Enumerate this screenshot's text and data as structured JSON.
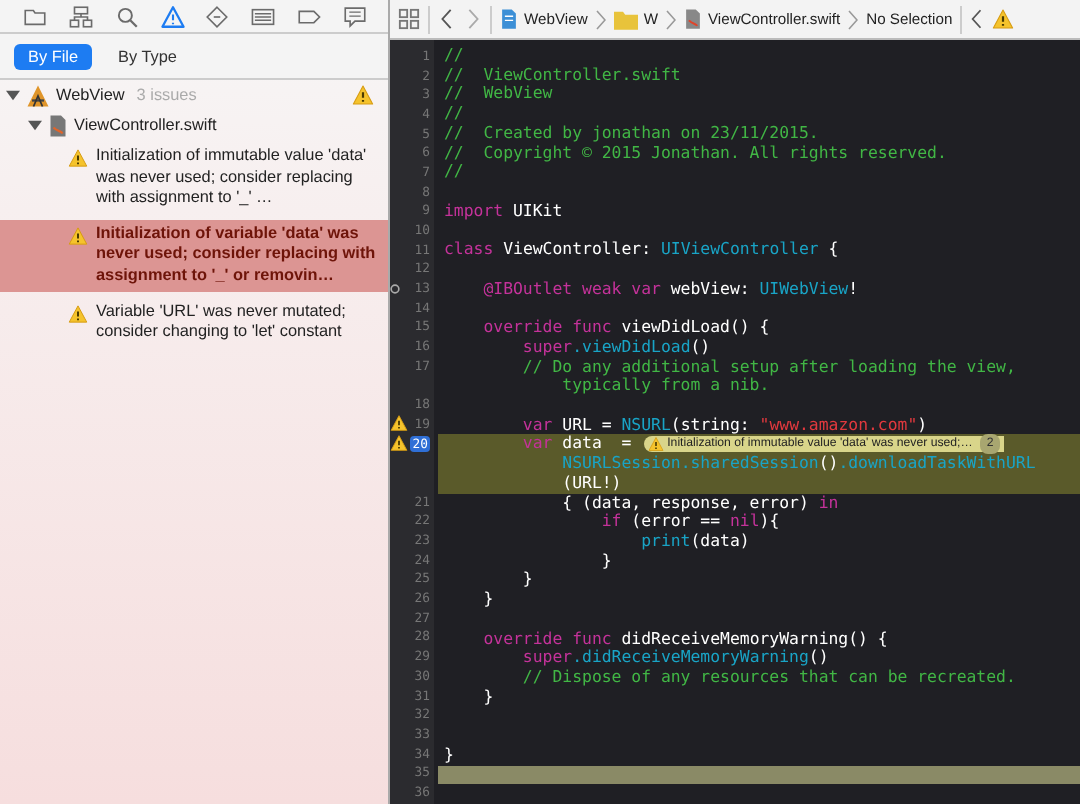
{
  "navigator": {
    "toolbar": [
      {
        "kind": "folder",
        "selected": false
      },
      {
        "kind": "hierarchy",
        "selected": false
      },
      {
        "kind": "search",
        "selected": false
      },
      {
        "kind": "warning",
        "selected": true
      },
      {
        "kind": "diamond",
        "selected": false
      },
      {
        "kind": "list",
        "selected": false
      },
      {
        "kind": "tag",
        "selected": false
      },
      {
        "kind": "bubble",
        "selected": false
      }
    ],
    "scope_tabs": [
      {
        "label": "By File",
        "selected": true
      },
      {
        "label": "By Type",
        "selected": false
      }
    ],
    "tree": {
      "label": "WebView",
      "count": "3 issues",
      "expanded": true,
      "children": [
        {
          "label": "ViewController.swift",
          "expanded": true,
          "children": [
            {
              "label": "Initialization of immutable value 'data' was never used; consider replacing with assignment to '_' …",
              "selected": false
            },
            {
              "label": "Initialization of variable 'data' was never used; consider replacing with assignment to '_' or removin…",
              "selected": true
            },
            {
              "label": "Variable 'URL' was never mutated; consider changing to 'let' constant",
              "selected": false
            }
          ]
        }
      ]
    }
  },
  "editor": {
    "jump_bar": [
      {
        "kind": "project",
        "label": "WebView"
      },
      {
        "kind": "folder",
        "label": "W"
      },
      {
        "kind": "file",
        "label": "ViewController.swift"
      },
      {
        "kind": "plain",
        "label": "No Selection"
      }
    ],
    "lines": [
      {
        "number": "1",
        "wraps": [
          {
            "tokens": [
              {
                "kind": "comment",
                "text": "//"
              }
            ]
          }
        ]
      },
      {
        "number": "2",
        "wraps": [
          {
            "tokens": [
              {
                "kind": "comment",
                "text": "//  ViewController.swift"
              }
            ]
          }
        ]
      },
      {
        "number": "3",
        "wraps": [
          {
            "tokens": [
              {
                "kind": "comment",
                "text": "//  WebView"
              }
            ]
          }
        ]
      },
      {
        "number": "4",
        "wraps": [
          {
            "tokens": [
              {
                "kind": "comment",
                "text": "//"
              }
            ]
          }
        ]
      },
      {
        "number": "5",
        "wraps": [
          {
            "tokens": [
              {
                "kind": "comment",
                "text": "//  Created by jonathan on 23/11/2015."
              }
            ]
          }
        ]
      },
      {
        "number": "6",
        "wraps": [
          {
            "tokens": [
              {
                "kind": "comment",
                "text": "//  Copyright © 2015 Jonathan. All rights reserved."
              }
            ]
          }
        ]
      },
      {
        "number": "7",
        "wraps": [
          {
            "tokens": [
              {
                "kind": "comment",
                "text": "//"
              }
            ]
          }
        ]
      },
      {
        "number": "8"
      },
      {
        "number": "9",
        "wraps": [
          {
            "tokens": [
              {
                "kind": "keyword",
                "text": "import"
              },
              {
                "kind": "plain",
                "text": " UIKit"
              }
            ]
          }
        ]
      },
      {
        "number": "10"
      },
      {
        "number": "11",
        "wraps": [
          {
            "tokens": [
              {
                "kind": "keyword",
                "text": "class"
              },
              {
                "kind": "plain",
                "text": " ViewController: "
              },
              {
                "kind": "type",
                "text": "UIViewController"
              },
              {
                "kind": "plain",
                "text": " {"
              }
            ]
          }
        ]
      },
      {
        "number": "12"
      },
      {
        "number": "13",
        "outlet": true,
        "wraps": [
          {
            "tokens": [
              {
                "kind": "keyword",
                "text": "    @IBOutlet weak var"
              },
              {
                "kind": "plain",
                "text": " webView: "
              },
              {
                "kind": "type",
                "text": "UIWebView"
              },
              {
                "kind": "plain",
                "text": "!"
              }
            ]
          }
        ]
      },
      {
        "number": "14"
      },
      {
        "number": "15",
        "wraps": [
          {
            "tokens": [
              {
                "kind": "keyword",
                "text": "    override func"
              },
              {
                "kind": "plain",
                "text": " viewDidLoad() {"
              }
            ]
          }
        ]
      },
      {
        "number": "16",
        "wraps": [
          {
            "tokens": [
              {
                "kind": "keyword",
                "text": "        super"
              },
              {
                "kind": "call",
                "text": ".viewDidLoad"
              },
              {
                "kind": "plain",
                "text": "()"
              }
            ]
          }
        ]
      },
      {
        "number": "17",
        "wraps": [
          {
            "tokens": [
              {
                "kind": "comment",
                "text": "        // Do any additional setup after loading the view,"
              }
            ]
          },
          {
            "tokens": [
              {
                "kind": "comment",
                "text": "            typically from a nib."
              }
            ]
          }
        ]
      },
      {
        "number": "18"
      },
      {
        "number": "19",
        "warning": true,
        "wraps": [
          {
            "tokens": [
              {
                "kind": "keyword",
                "text": "        var"
              },
              {
                "kind": "plain",
                "text": " URL = "
              },
              {
                "kind": "type",
                "text": "NSURL"
              },
              {
                "kind": "plain",
                "text": "(string: "
              },
              {
                "kind": "string",
                "text": "\"www.amazon.com\""
              },
              {
                "kind": "plain",
                "text": ")"
              }
            ]
          }
        ]
      },
      {
        "number": "20",
        "warning": true,
        "highlighted": true,
        "issue": {
          "message": "Initialization of immutable value 'data' was never used;…",
          "count": "2"
        },
        "wraps": [
          {
            "tokens": [
              {
                "kind": "keyword",
                "text": "        var"
              },
              {
                "kind": "plain",
                "text": " data  = "
              }
            ]
          },
          {
            "tokens": [
              {
                "kind": "type",
                "text": "            NSURLSession"
              },
              {
                "kind": "call",
                "text": ".sharedSession"
              },
              {
                "kind": "plain",
                "text": "()"
              },
              {
                "kind": "call",
                "text": ".downloadTaskWithURL"
              }
            ]
          },
          {
            "tokens": [
              {
                "kind": "plain",
                "text": "            (URL!)"
              }
            ]
          }
        ]
      },
      {
        "number": "21",
        "wraps": [
          {
            "tokens": [
              {
                "kind": "plain",
                "text": "            { (data, response, error) "
              },
              {
                "kind": "keyword",
                "text": "in"
              }
            ]
          }
        ]
      },
      {
        "number": "22",
        "wraps": [
          {
            "tokens": [
              {
                "kind": "keyword",
                "text": "                if"
              },
              {
                "kind": "plain",
                "text": " (error == "
              },
              {
                "kind": "keyword",
                "text": "nil"
              },
              {
                "kind": "plain",
                "text": "){"
              }
            ]
          }
        ]
      },
      {
        "number": "23",
        "wraps": [
          {
            "tokens": [
              {
                "kind": "call",
                "text": "                    print"
              },
              {
                "kind": "plain",
                "text": "(data)"
              }
            ]
          }
        ]
      },
      {
        "number": "24",
        "wraps": [
          {
            "tokens": [
              {
                "kind": "plain",
                "text": "                }"
              }
            ]
          }
        ]
      },
      {
        "number": "25",
        "wraps": [
          {
            "tokens": [
              {
                "kind": "plain",
                "text": "        }"
              }
            ]
          }
        ]
      },
      {
        "number": "26",
        "wraps": [
          {
            "tokens": [
              {
                "kind": "plain",
                "text": "    }"
              }
            ]
          }
        ]
      },
      {
        "number": "27"
      },
      {
        "number": "28",
        "wraps": [
          {
            "tokens": [
              {
                "kind": "keyword",
                "text": "    override func"
              },
              {
                "kind": "plain",
                "text": " didReceiveMemoryWarning() {"
              }
            ]
          }
        ]
      },
      {
        "number": "29",
        "wraps": [
          {
            "tokens": [
              {
                "kind": "keyword",
                "text": "        super"
              },
              {
                "kind": "call",
                "text": ".didReceiveMemoryWarning"
              },
              {
                "kind": "plain",
                "text": "()"
              }
            ]
          }
        ]
      },
      {
        "number": "30",
        "wraps": [
          {
            "tokens": [
              {
                "kind": "comment",
                "text": "        // Dispose of any resources that can be recreated."
              }
            ]
          }
        ]
      },
      {
        "number": "31",
        "wraps": [
          {
            "tokens": [
              {
                "kind": "plain",
                "text": "    }"
              }
            ]
          }
        ]
      },
      {
        "number": "32"
      },
      {
        "number": "33"
      },
      {
        "number": "34",
        "wraps": [
          {
            "tokens": [
              {
                "kind": "plain",
                "text": "}"
              }
            ]
          }
        ]
      },
      {
        "number": "35",
        "selected": true
      },
      {
        "number": "36"
      }
    ]
  }
}
